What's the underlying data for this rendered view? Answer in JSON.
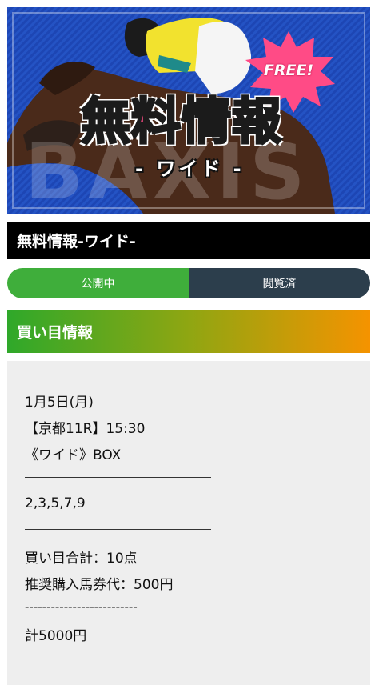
{
  "banner": {
    "watermark": "BAXIS",
    "badge": "FREE!",
    "title": "無料情報",
    "subtitle": "- ワイド -"
  },
  "page": {
    "title": "無料情報-ワイド-"
  },
  "status_tabs": [
    {
      "label": "公開中",
      "color": "#3fae3b"
    },
    {
      "label": "閲覧済",
      "color": "#2c3e4c"
    }
  ],
  "section": {
    "header": "買い目情報",
    "gradient": [
      "#2fa82a",
      "#f59300"
    ]
  },
  "tips": {
    "date": "1月5日(月)",
    "race": "【京都11R】15:30",
    "bet_type": "《ワイド》BOX",
    "numbers": "2,3,5,7,9",
    "total_points": "買い目合計：10点",
    "stake": "推奨購入馬券代：500円",
    "dashes": "--------------------------",
    "total": "計5000円"
  }
}
